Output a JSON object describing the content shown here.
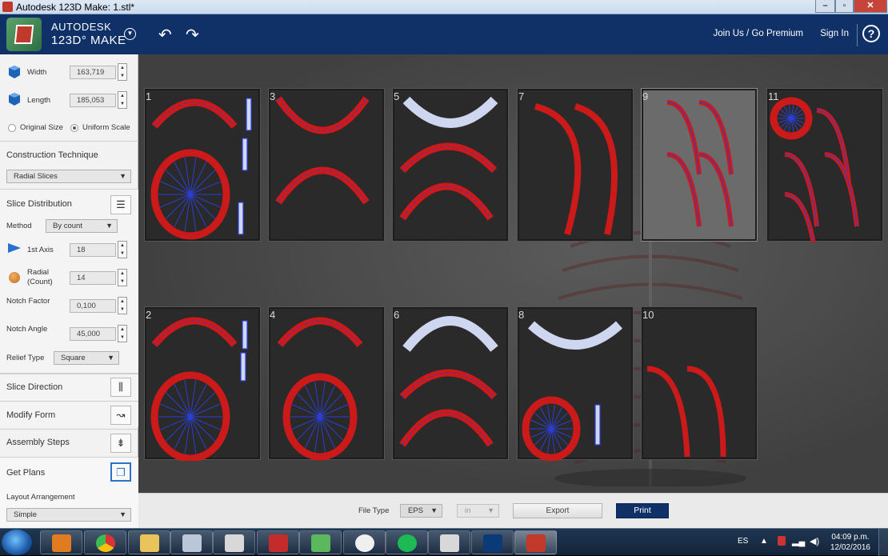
{
  "window": {
    "title": "Autodesk 123D Make: 1.stl*"
  },
  "header": {
    "brand_line1": "AUTODESK",
    "brand_line2": "123D° MAKE",
    "join_label": "Join Us / Go Premium",
    "signin_label": "Sign In",
    "help_label": "?"
  },
  "panel": {
    "width_label": "Width",
    "width_value": "163,719",
    "length_label": "Length",
    "length_value": "185,053",
    "original_size_label": "Original Size",
    "uniform_scale_label": "Uniform Scale",
    "construction_label": "Construction Technique",
    "construction_value": "Radial Slices",
    "slice_distribution_label": "Slice Distribution",
    "method_label": "Method",
    "method_value": "By count",
    "axis1_label": "1st Axis",
    "axis1_value": "18",
    "radial_label": "Radial",
    "radial_sub": "(Count)",
    "radial_value": "14",
    "notch_factor_label": "Notch Factor",
    "notch_factor_value": "0,100",
    "notch_angle_label": "Notch Angle",
    "notch_angle_value": "45,000",
    "relief_label": "Relief Type",
    "relief_value": "Square",
    "slice_direction_label": "Slice Direction",
    "modify_form_label": "Modify Form",
    "assembly_label": "Assembly Steps",
    "get_plans_label": "Get Plans",
    "layout_label": "Layout Arrangement",
    "layout_value": "Simple"
  },
  "sheets": [
    "1",
    "3",
    "5",
    "7",
    "9",
    "11",
    "2",
    "4",
    "6",
    "8",
    "10"
  ],
  "bottom": {
    "file_type_label": "File Type",
    "file_type_value": "EPS",
    "unit_value": "in",
    "export_label": "Export",
    "print_label": "Print"
  },
  "taskbar": {
    "lang": "ES",
    "time": "04:09 p.m.",
    "date": "12/02/2016"
  },
  "colors": {
    "header": "#0f3168",
    "slice_red": "#cc1a1a",
    "slice_blue": "#2a3fd6"
  }
}
